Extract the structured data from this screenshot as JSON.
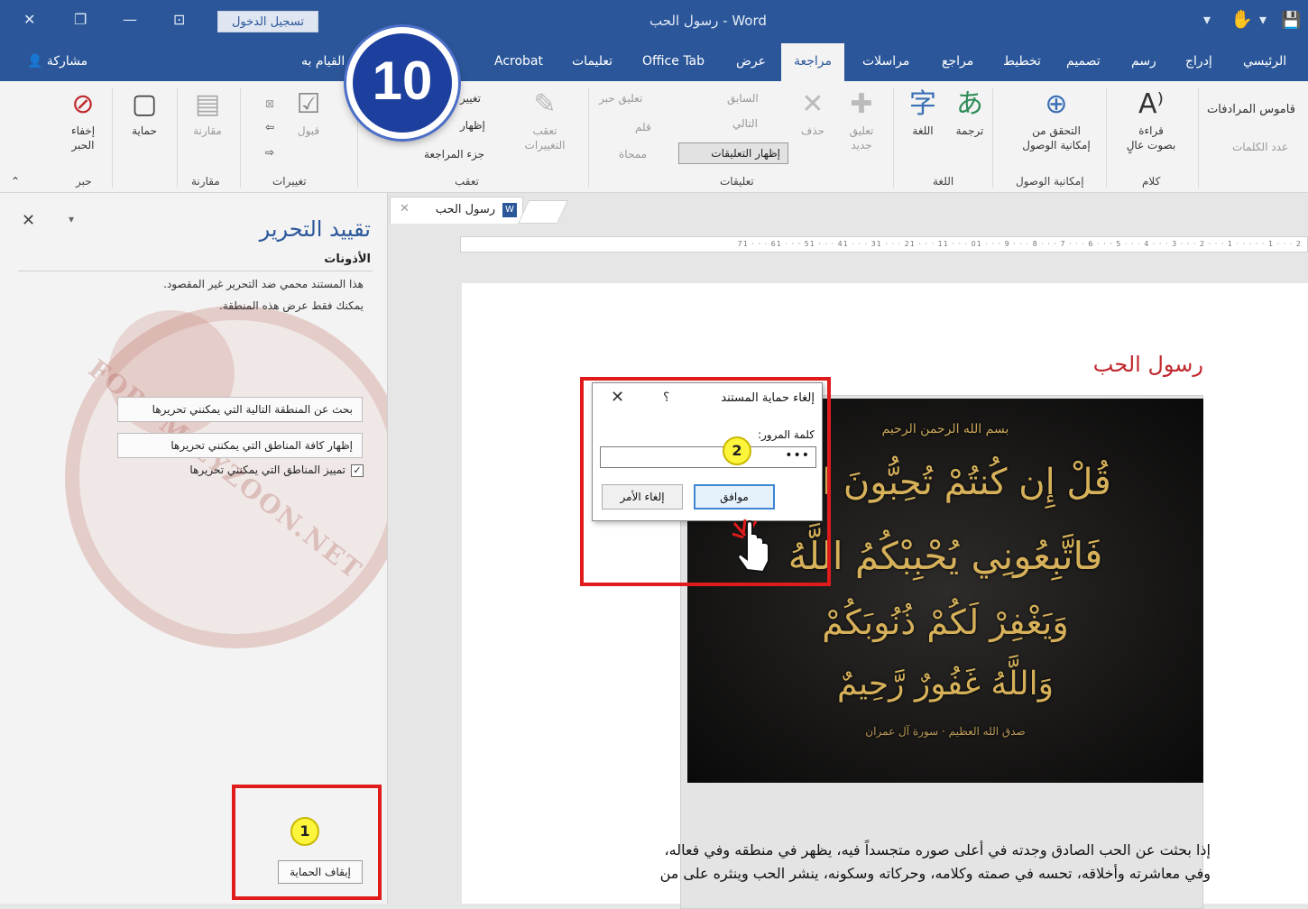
{
  "titlebar": {
    "signin_label": "تسجيل الدخول",
    "app_title": "رسول الحب  -  Word"
  },
  "ribbon_tabs": {
    "home": "الرئيسي",
    "insert": "إدراج",
    "draw": "رسم",
    "design": "تصميم",
    "layout": "تخطيط",
    "references": "مراجع",
    "mailings": "مراسلات",
    "review": "مراجعة",
    "view": "عرض",
    "office_tab": "Office Tab",
    "help": "تعليمات",
    "acrobat": "Acrobat",
    "tell_me": "القيام به",
    "share": "مشاركة"
  },
  "ribbon": {
    "thesaurus": "قاموس المرادفات",
    "word_count": "عدد الكلمات",
    "read_aloud": "قراءة\nبصوت عالٍ",
    "speech_group": "كلام",
    "check_accessibility": "التحقق من\nإمكانية الوصول",
    "accessibility_group": "إمكانية الوصول",
    "translate": "ترجمة",
    "language": "اللغة",
    "language_group": "اللغة",
    "new_comment": "تعليق\nجديد",
    "delete": "حذف",
    "previous": "السابق",
    "next": "التالي",
    "show_comments": "إظهار التعليقات",
    "no_comment": "تعليق حبر",
    "ink": "قلم",
    "eraser": "ممحاة",
    "comments_group": "تعليقات",
    "track_changes": "تعقب\nالتغييرات",
    "track_tracking": "تعقب",
    "show_markup": "إظهار",
    "review_pane": "جزء المراجعة",
    "markup_short": "تغيير",
    "accept": "قبول",
    "changes_group": "تغييرات",
    "compare": "مقارنة",
    "compare_group": "مقارنة",
    "protect": "حماية",
    "hide_ink": "إخفاء\nالحبر",
    "ink_group": "حبر"
  },
  "restrict_pane": {
    "title": "تقييد التحرير",
    "subtitle": "الأذونات",
    "note_line1": "هذا المستند محمي ضد التحرير غير المقصود.",
    "note_line2": "يمكنك فقط عرض هذه المنطقة.",
    "find_next_btn": "بحث عن المنطقة التالية التي يمكنني تحريرها",
    "show_all_btn": "إظهار كافة المناطق التي يمكنني تحريرها",
    "highlight_label": "تمييز المناطق التي يمكنني تحريرها",
    "highlight_checked": "✓",
    "stop_protection_btn": "إيقاف الحماية",
    "watermark": "FORUM.ZYZOON.NET"
  },
  "document": {
    "tab_label": "رسول الحب",
    "ruler": "2 · · · 1 · · · · · 1 · · · 2 · · · 3 · · · 4 · · · 5 · · · 6 · · · 7 · · · 8 · · · 9 · · · 01 · · · 11 · · · 21 · · · 31 · · · 41 · · · 51 · · · 61 · · · 71",
    "heading": "رسول الحب",
    "image": {
      "bismillah": "بسم الله الرحمن الرحيم",
      "verse_1": "قُلْ إِن كُنتُمْ تُحِبُّونَ اللَّهَ",
      "verse_2": "فَاتَّبِعُونِي يُحْبِبْكُمُ اللَّهُ",
      "verse_3": "وَيَغْفِرْ لَكُمْ ذُنُوبَكُمْ",
      "verse_4": "وَاللَّهُ غَفُورٌ رَّحِيمٌ",
      "source": "صدق الله العظيم · سورة آل عمران"
    },
    "body_line1": "إذا بحثت عن الحب الصادق وجدته في أعلى صوره متجسداً فيه، يظهر في منطقه وفي فعاله،",
    "body_line2": "وفي معاشرته وأخلاقه، تحسه في صمته وكلامه، وحركاته وسكونه، ينشر الحب وينثره على من"
  },
  "dialog": {
    "title": "إلغاء حماية المستند",
    "help": "؟",
    "password_label": "كلمة المرور:",
    "password_value": "•••",
    "ok": "موافق",
    "cancel": "إلغاء الأمر"
  },
  "annotations": {
    "step_1": "1",
    "step_2": "2",
    "big_step": "10",
    "highlight_color": "#e01b1b",
    "circle_color": "#fdf53b"
  }
}
